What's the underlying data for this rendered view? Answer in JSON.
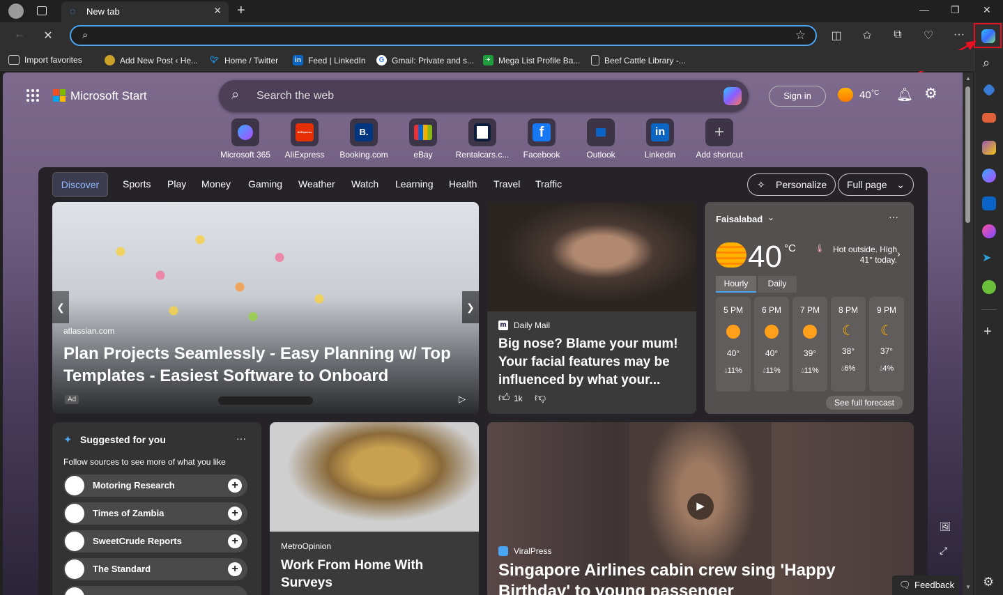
{
  "tab": {
    "title": "New tab"
  },
  "toolbar": {
    "address_value": ""
  },
  "bookmarks": [
    {
      "label": "Import favorites"
    },
    {
      "label": "Add New Post ‹ He..."
    },
    {
      "label": "Home / Twitter"
    },
    {
      "label": "Feed | LinkedIn"
    },
    {
      "label": "Gmail: Private and s..."
    },
    {
      "label": "Mega List Profile Ba..."
    },
    {
      "label": "Beef Cattle Library -..."
    }
  ],
  "header": {
    "brand": "Microsoft Start",
    "search_placeholder": "Search the web",
    "signin": "Sign in",
    "temp": "40",
    "temp_unit": "°C"
  },
  "shortcuts": [
    {
      "label": "Microsoft 365",
      "glyph": ""
    },
    {
      "label": "AliExpress",
      "glyph": "AliExpress"
    },
    {
      "label": "Booking.com",
      "glyph": "B."
    },
    {
      "label": "eBay",
      "glyph": ""
    },
    {
      "label": "Rentalcars.c...",
      "glyph": ""
    },
    {
      "label": "Facebook",
      "glyph": "f"
    },
    {
      "label": "Outlook",
      "glyph": ""
    },
    {
      "label": "Linkedin",
      "glyph": "in"
    },
    {
      "label": "Add shortcut",
      "glyph": "+"
    }
  ],
  "nav": {
    "tabs": [
      "Discover",
      "Sports",
      "Play",
      "Money",
      "Gaming",
      "Weather",
      "Watch",
      "Learning",
      "Health",
      "Travel",
      "Traffic"
    ],
    "personalize": "Personalize",
    "fullpage": "Full page"
  },
  "hero": {
    "source": "atlassian.com",
    "title": "Plan Projects Seamlessly - Easy Planning w/ Top Templates - Easiest Software to Onboard",
    "ad": "Ad"
  },
  "story1": {
    "source": "Daily Mail",
    "title": "Big nose? Blame your mum! Your facial features may be influenced by what your...",
    "likes": "1k"
  },
  "weather": {
    "city": "Faisalabad",
    "temp": "40",
    "unit": "°C",
    "desc": "Hot outside. High 41° today.",
    "tabs": [
      "Hourly",
      "Daily"
    ],
    "hours": [
      {
        "t": "5 PM",
        "temp": "40°",
        "rain": "11%"
      },
      {
        "t": "6 PM",
        "temp": "40°",
        "rain": "11%"
      },
      {
        "t": "7 PM",
        "temp": "39°",
        "rain": "11%"
      },
      {
        "t": "8 PM",
        "temp": "38°",
        "rain": "6%"
      },
      {
        "t": "9 PM",
        "temp": "37°",
        "rain": "4%"
      }
    ],
    "forecast": "See full forecast"
  },
  "suggested": {
    "title": "Suggested for you",
    "subtitle": "Follow sources to see more of what you like",
    "items": [
      "Motoring Research",
      "Times of Zambia",
      "SweetCrude Reports",
      "The Standard"
    ]
  },
  "story2": {
    "source": "MetroOpinion",
    "title": "Work From Home With Surveys"
  },
  "story3": {
    "source": "ViralPress",
    "title": "Singapore Airlines cabin crew sing 'Happy Birthday' to young passenger"
  },
  "feedback": "Feedback",
  "colors": {
    "accent": "#4aa5f3",
    "highlight": "#e81123"
  }
}
